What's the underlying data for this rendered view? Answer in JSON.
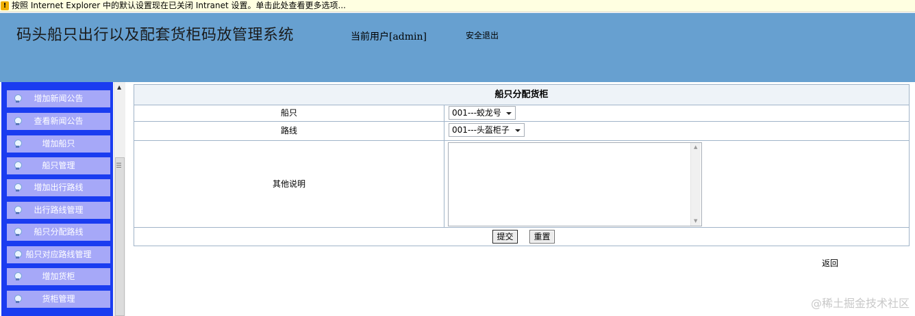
{
  "infobar": {
    "icon": "warning-shield-icon",
    "text": "按照 Internet Explorer 中的默认设置现在已关闭 Intranet 设置。单击此处查看更多选项..."
  },
  "header": {
    "title": "码头船只出行以及配套货柜码放管理系统",
    "current_user": "当前用户[admin]",
    "logout": "安全退出",
    "bg_color": "#67a0d0"
  },
  "sidebar": {
    "menu_color": "#1a3cf0",
    "item_color": "#a6a8f8",
    "items": [
      {
        "label": "增加新闻公告"
      },
      {
        "label": "查看新闻公告"
      },
      {
        "label": "增加船只"
      },
      {
        "label": "船只管理"
      },
      {
        "label": "增加出行路线"
      },
      {
        "label": "出行路线管理"
      },
      {
        "label": "船只分配路线"
      },
      {
        "label": "船只对应路线管理"
      },
      {
        "label": "增加货柜"
      },
      {
        "label": "货柜管理"
      }
    ]
  },
  "form": {
    "title": "船只分配货柜",
    "ship_label": "船只",
    "ship_value": "001---蛟龙号",
    "route_label": "路线",
    "route_value": "001---头盔柜子",
    "notes_label": "其他说明",
    "notes_value": "",
    "submit_label": "提交",
    "reset_label": "重置"
  },
  "back_label": "返回",
  "watermark": "@稀土掘金技术社区"
}
